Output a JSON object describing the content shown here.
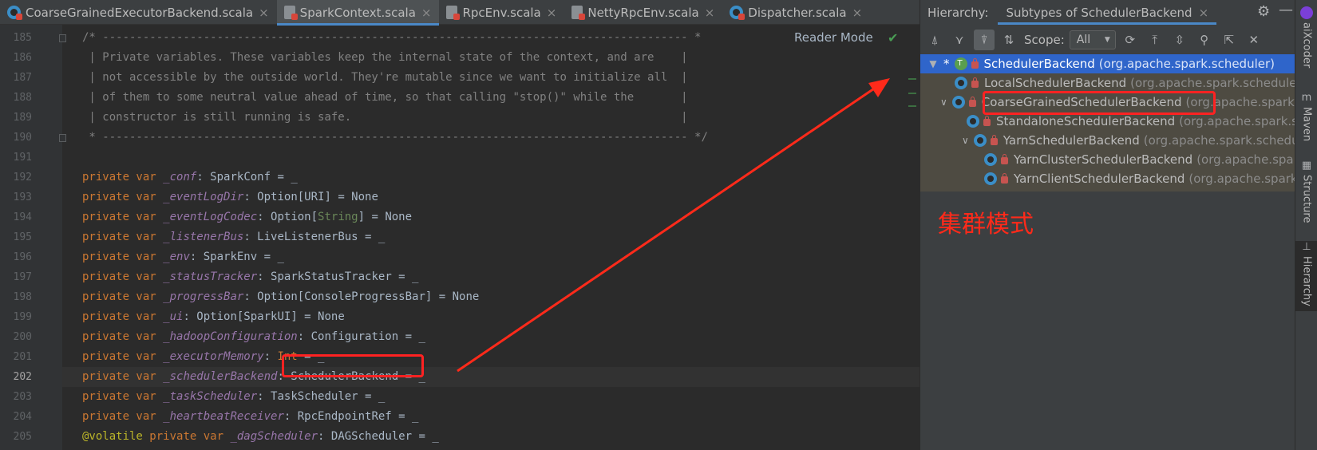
{
  "editor_tabs": [
    {
      "label": "CoarseGrainedExecutorBackend.scala",
      "close": "×",
      "icon": "scala-object-icon",
      "active": false
    },
    {
      "label": "SparkContext.scala",
      "close": "×",
      "icon": "scala-file-icon",
      "active": true
    },
    {
      "label": "RpcEnv.scala",
      "close": "×",
      "icon": "scala-file-icon",
      "active": false
    },
    {
      "label": "NettyRpcEnv.scala",
      "close": "×",
      "icon": "scala-file-icon",
      "active": false
    },
    {
      "label": "Dispatcher.scala",
      "close": "×",
      "icon": "scala-object-icon",
      "active": false
    }
  ],
  "reader_mode": "Reader Mode",
  "current_line": "202",
  "code_lines": [
    {
      "no": "185",
      "parts": [
        [
          "cm",
          "/* --------------------------------------------------------------------------------------- *"
        ]
      ]
    },
    {
      "no": "186",
      "parts": [
        [
          "cm",
          " | Private variables. These variables keep the internal state of the context, and are    |"
        ]
      ]
    },
    {
      "no": "187",
      "parts": [
        [
          "cm",
          " | not accessible by the outside world. They're mutable since we want to initialize all  |"
        ]
      ]
    },
    {
      "no": "188",
      "parts": [
        [
          "cm",
          " | of them to some neutral value ahead of time, so that calling \"stop()\" while the       |"
        ]
      ]
    },
    {
      "no": "189",
      "parts": [
        [
          "cm",
          " | constructor is still running is safe.                                                 |"
        ]
      ]
    },
    {
      "no": "190",
      "parts": [
        [
          "cm",
          " * --------------------------------------------------------------------------------------- */"
        ]
      ]
    },
    {
      "no": "191",
      "parts": []
    },
    {
      "no": "192",
      "parts": [
        [
          "kw",
          "private var "
        ],
        [
          "fld",
          "_conf"
        ],
        [
          "ty",
          ": SparkConf = _"
        ]
      ]
    },
    {
      "no": "193",
      "parts": [
        [
          "kw",
          "private var "
        ],
        [
          "fld",
          "_eventLogDir"
        ],
        [
          "ty",
          ": Option[URI] = None"
        ]
      ]
    },
    {
      "no": "194",
      "parts": [
        [
          "kw",
          "private var "
        ],
        [
          "fld",
          "_eventLogCodec"
        ],
        [
          "ty",
          ": Option["
        ],
        [
          "lib",
          "String"
        ],
        [
          "ty",
          "] = None"
        ]
      ]
    },
    {
      "no": "195",
      "parts": [
        [
          "kw",
          "private var "
        ],
        [
          "fld",
          "_listenerBus"
        ],
        [
          "ty",
          ": LiveListenerBus = _"
        ]
      ]
    },
    {
      "no": "196",
      "parts": [
        [
          "kw",
          "private var "
        ],
        [
          "fld",
          "_env"
        ],
        [
          "ty",
          ": SparkEnv = _"
        ]
      ]
    },
    {
      "no": "197",
      "parts": [
        [
          "kw",
          "private var "
        ],
        [
          "fld",
          "_statusTracker"
        ],
        [
          "ty",
          ": SparkStatusTracker = _"
        ]
      ]
    },
    {
      "no": "198",
      "parts": [
        [
          "kw",
          "private var "
        ],
        [
          "fld",
          "_progressBar"
        ],
        [
          "ty",
          ": Option[ConsoleProgressBar] = None"
        ]
      ]
    },
    {
      "no": "199",
      "parts": [
        [
          "kw",
          "private var "
        ],
        [
          "fld",
          "_ui"
        ],
        [
          "ty",
          ": Option[SparkUI] = None"
        ]
      ]
    },
    {
      "no": "200",
      "parts": [
        [
          "kw",
          "private var "
        ],
        [
          "fld",
          "_hadoopConfiguration"
        ],
        [
          "ty",
          ": Configuration = _"
        ]
      ]
    },
    {
      "no": "201",
      "parts": [
        [
          "kw",
          "private var "
        ],
        [
          "fld",
          "_executorMemory"
        ],
        [
          "ty",
          ": "
        ],
        [
          "kw",
          "Int"
        ],
        [
          "ty",
          " = _"
        ]
      ]
    },
    {
      "no": "202",
      "parts": [
        [
          "kw",
          "private var "
        ],
        [
          "fld",
          "_schedulerBackend"
        ],
        [
          "ty",
          ": SchedulerBackend = _"
        ]
      ]
    },
    {
      "no": "203",
      "parts": [
        [
          "kw",
          "private var "
        ],
        [
          "fld",
          "_taskScheduler"
        ],
        [
          "ty",
          ": TaskScheduler = _"
        ]
      ]
    },
    {
      "no": "204",
      "parts": [
        [
          "kw",
          "private var "
        ],
        [
          "fld",
          "_heartbeatReceiver"
        ],
        [
          "ty",
          ": RpcEndpointRef = _"
        ]
      ]
    },
    {
      "no": "205",
      "parts": [
        [
          "ann",
          "@volatile "
        ],
        [
          "kw",
          "private var "
        ],
        [
          "fld",
          "_dagScheduler"
        ],
        [
          "ty",
          ": DAGScheduler = _"
        ]
      ]
    }
  ],
  "hierarchy": {
    "title": "Hierarchy:",
    "tab_label": "Subtypes of SchedulerBackend",
    "tab_close": "×",
    "gear_icon": "⚙",
    "minimize_icon": "—",
    "toolbar": {
      "buttons": [
        {
          "name": "supertypes-hierarchy-button",
          "glyph": "⍋"
        },
        {
          "name": "class-hierarchy-button",
          "glyph": "⋎"
        },
        {
          "name": "subtypes-hierarchy-button",
          "glyph": "⍒"
        },
        {
          "name": "sort-alphabetically-button",
          "glyph": "⇅"
        }
      ],
      "scope_label": "Scope:",
      "scope_value": "All",
      "right_buttons": [
        {
          "name": "refresh-button",
          "glyph": "⟳"
        },
        {
          "name": "export-button",
          "glyph": "⤒"
        },
        {
          "name": "expand-all-button",
          "glyph": "⇳"
        },
        {
          "name": "pin-button",
          "glyph": "⚲"
        },
        {
          "name": "open-in-window-button",
          "glyph": "⇱"
        },
        {
          "name": "close-panel-button",
          "glyph": "✕"
        }
      ]
    },
    "tree": [
      {
        "name": "SchedulerBackend",
        "pkg": "(org.apache.spark.scheduler)",
        "level": 0,
        "chevron": "▼",
        "star": "*",
        "kind": "trait",
        "selected": true
      },
      {
        "name": "LocalSchedulerBackend",
        "pkg": "(org.apache.spark.scheduler.local)",
        "level": 1,
        "chevron": "",
        "star": "",
        "kind": "class",
        "selected": false
      },
      {
        "name": "CoarseGrainedSchedulerBackend",
        "pkg": "(org.apache.spark.scheduler.cluster)",
        "level": 1,
        "chevron": "∨",
        "star": "",
        "kind": "class",
        "selected": false
      },
      {
        "name": "StandaloneSchedulerBackend",
        "pkg": "(org.apache.spark.scheduler.cluster)",
        "level": 2,
        "chevron": "",
        "star": "",
        "kind": "class",
        "selected": false
      },
      {
        "name": "YarnSchedulerBackend",
        "pkg": "(org.apache.spark.scheduler.cluster)",
        "level": 2,
        "chevron": "∨",
        "star": "",
        "kind": "class",
        "selected": false
      },
      {
        "name": "YarnClusterSchedulerBackend",
        "pkg": "(org.apache.spark.scheduler.cluster)",
        "level": 3,
        "chevron": "",
        "star": "",
        "kind": "class",
        "selected": false
      },
      {
        "name": "YarnClientSchedulerBackend",
        "pkg": "(org.apache.spark.scheduler.cluster)",
        "level": 3,
        "chevron": "",
        "star": "",
        "kind": "class",
        "selected": false
      }
    ]
  },
  "annotation_text": "集群模式",
  "annotation_color": "#ff2a1a",
  "right_sidebar": [
    {
      "label": "aiXcoder",
      "icon": "aixcoder-icon"
    },
    {
      "label": "Maven",
      "icon": "maven-icon",
      "glyph": "m"
    },
    {
      "label": "Structure",
      "icon": "structure-icon",
      "glyph": "▦"
    },
    {
      "label": "Hierarchy",
      "icon": "hierarchy-icon",
      "glyph": "⊥",
      "active": true
    }
  ]
}
